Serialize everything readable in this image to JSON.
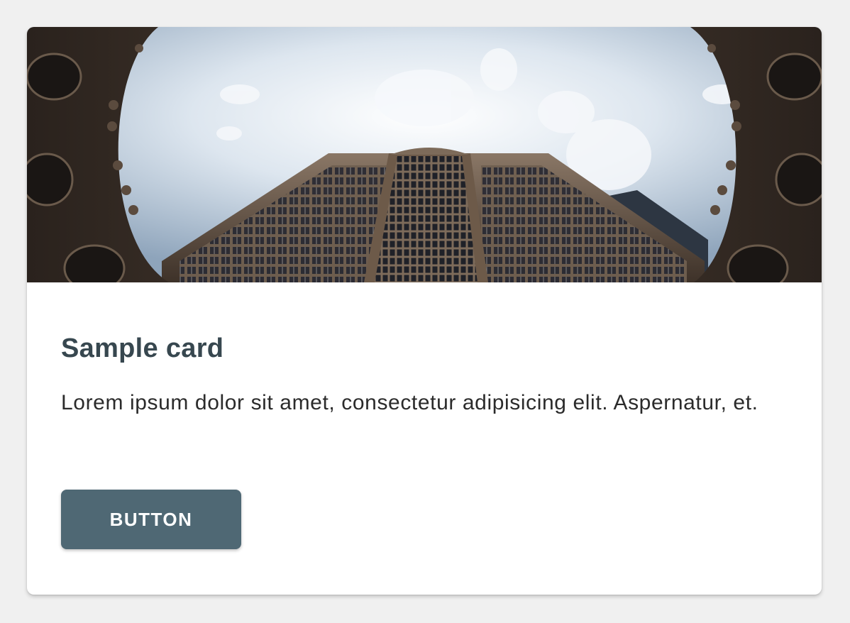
{
  "card": {
    "image_alt": "Low-angle view of a tall building framed by a circular archway against a cloudy sky",
    "title": "Sample card",
    "text": "Lorem ipsum dolor sit amet, consectetur adipisicing elit. Aspernatur, et.",
    "button_label": "BUTTON"
  },
  "colors": {
    "page_background": "#f0f0f0",
    "card_background": "#ffffff",
    "title": "#37474f",
    "body_text": "#2b2b2b",
    "button_background": "#4f6874",
    "button_text": "#ffffff"
  }
}
